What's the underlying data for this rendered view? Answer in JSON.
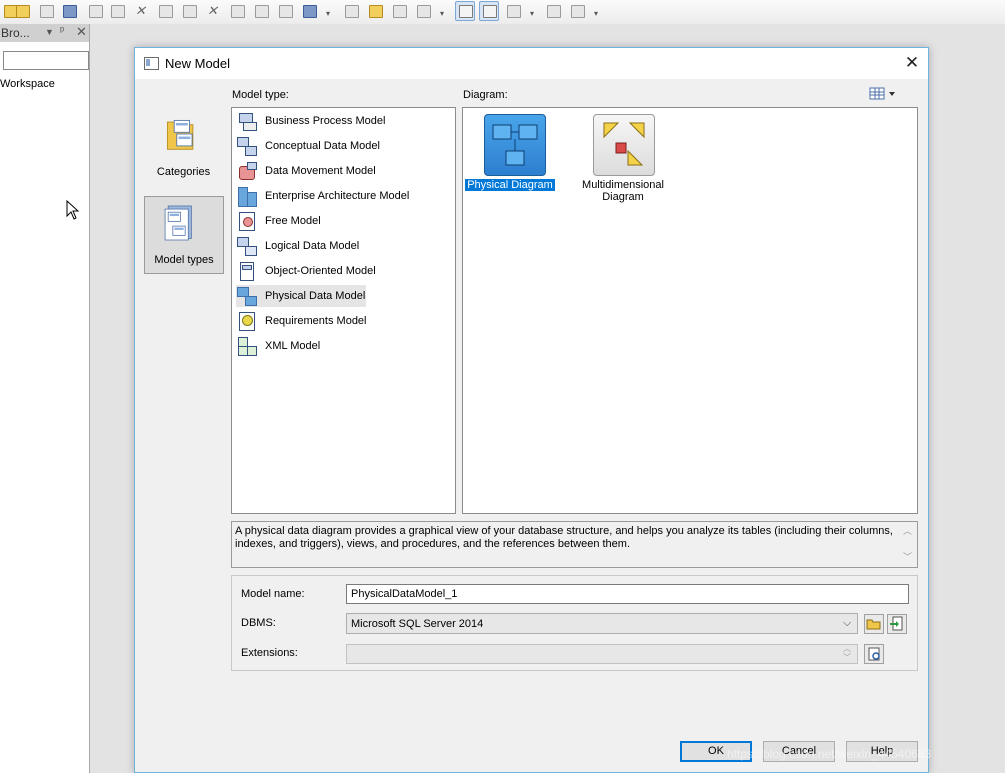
{
  "browser": {
    "title": "Bro...",
    "workspace_label": "Workspace"
  },
  "dialog": {
    "title": "New Model",
    "categories_label": "Categories",
    "model_types_label": "Model types",
    "model_type_header": "Model type:",
    "diagram_header": "Diagram:",
    "model_types": [
      {
        "label": "Business Process Model",
        "icon": "business-process-icon"
      },
      {
        "label": "Conceptual Data Model",
        "icon": "conceptual-data-icon"
      },
      {
        "label": "Data Movement Model",
        "icon": "data-movement-icon"
      },
      {
        "label": "Enterprise Architecture Model",
        "icon": "enterprise-architecture-icon"
      },
      {
        "label": "Free Model",
        "icon": "free-model-icon"
      },
      {
        "label": "Logical Data Model",
        "icon": "logical-data-icon"
      },
      {
        "label": "Object-Oriented Model",
        "icon": "object-oriented-icon"
      },
      {
        "label": "Physical Data Model",
        "icon": "physical-data-icon",
        "selected": true
      },
      {
        "label": "Requirements Model",
        "icon": "requirements-icon"
      },
      {
        "label": "XML Model",
        "icon": "xml-model-icon"
      }
    ],
    "diagrams": [
      {
        "label": "Physical Diagram",
        "selected": true
      },
      {
        "label_line1": "Multidimensional",
        "label_line2": "Diagram"
      }
    ],
    "description": "A physical data diagram provides a graphical view of your database structure, and helps you analyze its tables (including their columns, indexes, and triggers), views, and procedures, and the references between them.",
    "fields": {
      "model_name_label": "Model name:",
      "model_name_value": "PhysicalDataModel_1",
      "dbms_label": "DBMS:",
      "dbms_value": "Microsoft SQL Server 2014",
      "extensions_label": "Extensions:"
    },
    "buttons": {
      "ok": "OK",
      "cancel": "Cancel",
      "help": "Help"
    }
  },
  "watermark": "https://blog.csdn.net/weixin_44540683",
  "colors": {
    "accent": "#0078d7",
    "dialog_border": "#6fb2dc",
    "selection": "#0078d7"
  }
}
